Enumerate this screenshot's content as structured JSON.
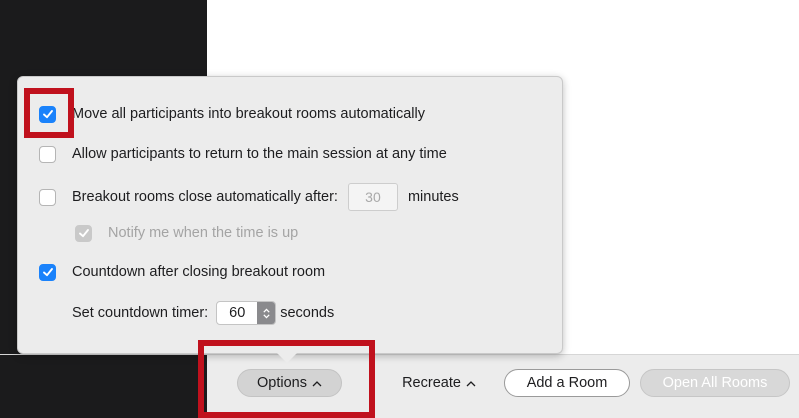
{
  "colors": {
    "accent": "#1a82fb",
    "highlight": "#c0111d",
    "dark_panel": "#1b1b1c"
  },
  "options_popover": {
    "items": [
      {
        "label": "Move all participants into breakout rooms automatically",
        "checked": true
      },
      {
        "label": "Allow participants to return to the main session at any time",
        "checked": false
      },
      {
        "label": "Breakout rooms close automatically after:",
        "checked": false,
        "minutes_value": "30",
        "minutes_unit": "minutes"
      },
      {
        "label": "Notify me when the time is up",
        "checked": true,
        "disabled": true
      },
      {
        "label": "Countdown after closing breakout room",
        "checked": true
      }
    ],
    "countdown": {
      "label": "Set countdown timer:",
      "value": "60",
      "unit": "seconds"
    }
  },
  "bottom_bar": {
    "options_label": "Options",
    "recreate_label": "Recreate",
    "add_room_label": "Add a Room",
    "open_all_label": "Open All Rooms"
  },
  "icons": {
    "check": "check-icon",
    "chevron_up": "chevron-up-icon",
    "stepper": "up-down-arrows-icon"
  }
}
